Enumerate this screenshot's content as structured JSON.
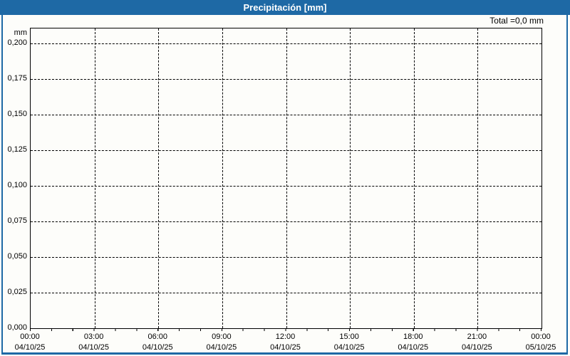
{
  "window": {
    "title": "Precipitación [mm]",
    "total_label": "Total =0,0 mm"
  },
  "colors": {
    "titlebar": "#1e69a5",
    "frame": "#1e69a5",
    "grid": "#000000",
    "plot_border": "#000000",
    "background": "#fdfdfa",
    "title_text": "#ffffff",
    "label_text": "#000000"
  },
  "chart_data": {
    "type": "bar",
    "title": "Precipitación [mm]",
    "subtitle": "",
    "xlabel": "",
    "ylabel": "mm",
    "total_annotation": "Total =0,0 mm",
    "grid": "dashed",
    "legend": "none",
    "ylim": [
      0,
      0.2105
    ],
    "y_axis": {
      "unit": "mm",
      "tick_labels": [
        "0,200",
        "0,175",
        "0,150",
        "0,125",
        "0,100",
        "0,075",
        "0,050",
        "0,025",
        "0,000"
      ],
      "tick_values": [
        0.2,
        0.175,
        0.15,
        0.125,
        0.1,
        0.075,
        0.05,
        0.025,
        0.0
      ]
    },
    "x_axis": {
      "major_divisions": 8,
      "minor_tick_count": 24,
      "tick_times": [
        "00:00",
        "03:00",
        "06:00",
        "09:00",
        "12:00",
        "15:00",
        "18:00",
        "21:00",
        "00:00"
      ],
      "tick_dates": [
        "04/10/25",
        "04/10/25",
        "04/10/25",
        "04/10/25",
        "04/10/25",
        "04/10/25",
        "04/10/25",
        "04/10/25",
        "05/10/25"
      ]
    },
    "series": [
      {
        "name": "Precipitación",
        "values": [],
        "total_mm": 0.0
      }
    ]
  }
}
